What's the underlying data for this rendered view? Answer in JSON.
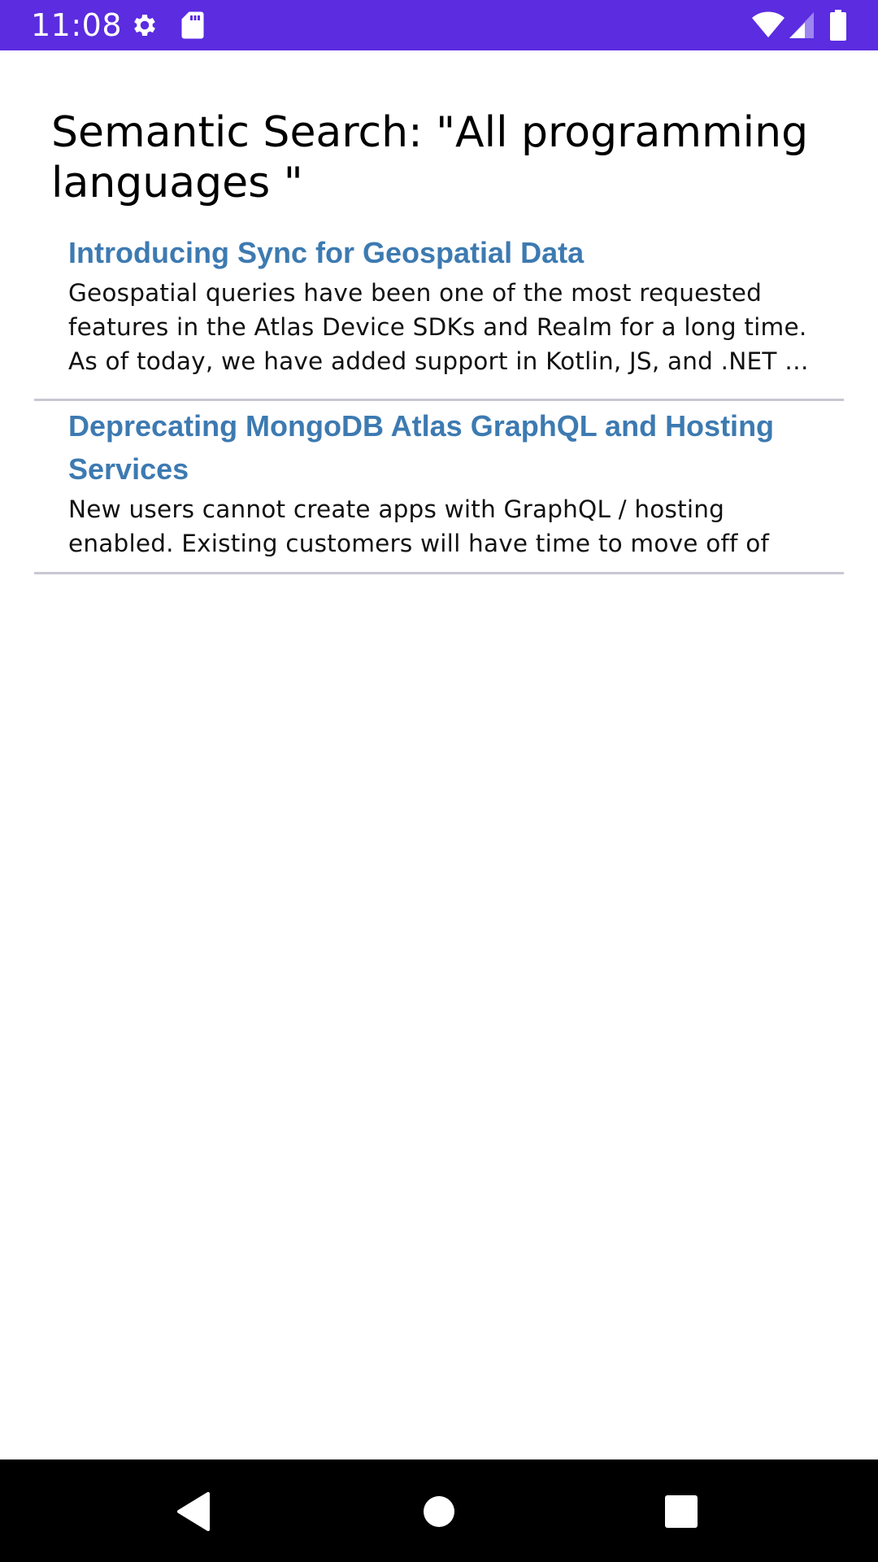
{
  "status_bar": {
    "time": "11:08",
    "background_color": "#5b2ce0",
    "icons": [
      "gear-icon",
      "sd-card-icon",
      "wifi-icon",
      "signal-icon",
      "battery-icon"
    ]
  },
  "page": {
    "title": "Semantic Search: \"All programming languages \""
  },
  "results": [
    {
      "title": "Introducing Sync for Geospatial Data",
      "summary": "Geospatial queries have been one of the most requested features in the Atlas Device SDKs and Realm for a long time. As of today, we have added support in Kotlin, JS, and .NET …"
    },
    {
      "title": "Deprecating MongoDB Atlas GraphQL and Hosting Services",
      "summary": "New users cannot create apps with GraphQL / hosting enabled. Existing customers will have time to move off of t…"
    }
  ],
  "colors": {
    "link": "#3d7ab1",
    "divider": "#c8c8d4",
    "nav_bar": "#000000"
  },
  "nav_bar": {
    "buttons": [
      "back-icon",
      "home-icon",
      "recents-icon"
    ]
  }
}
